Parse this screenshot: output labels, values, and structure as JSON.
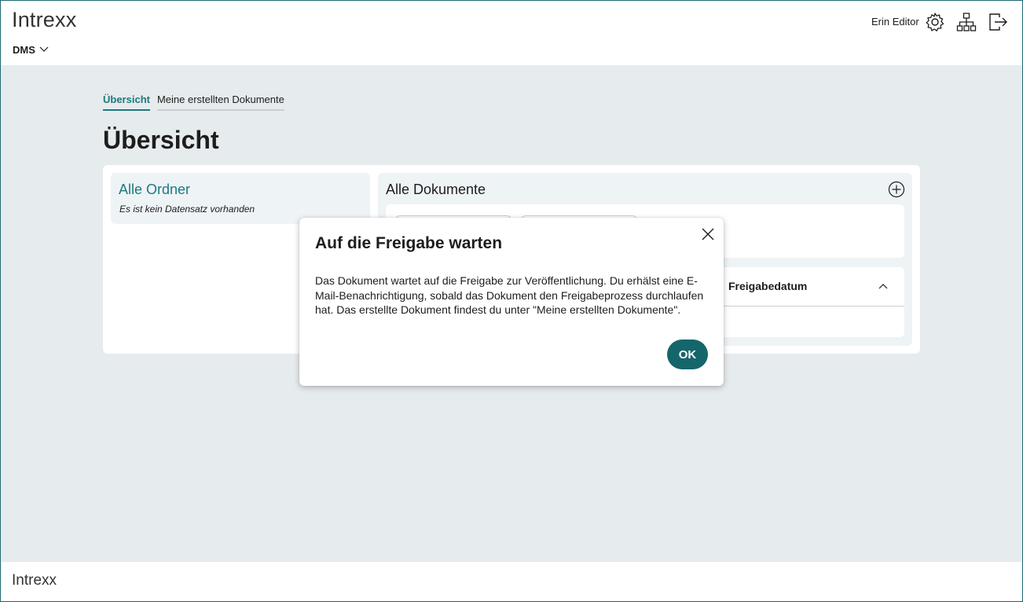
{
  "header": {
    "logo": "Intrexx",
    "app_menu_label": "DMS",
    "user_name": "Erin Editor",
    "icons": [
      "gear-icon",
      "sitemap-icon",
      "logout-icon"
    ]
  },
  "tabs": [
    {
      "label": "Übersicht",
      "active": true
    },
    {
      "label": "Meine erstellten Dokumente",
      "active": false
    }
  ],
  "page_title": "Übersicht",
  "folders": {
    "title": "Alle Ordner",
    "empty_text": "Es ist kein Datensatz vorhanden"
  },
  "documents": {
    "title": "Alle Dokumente",
    "column_header": "Freigabedatum"
  },
  "dialog": {
    "title": "Auf die Freigabe warten",
    "message": "Das Dokument wartet auf die Freigabe zur Veröffentlichung. Du erhälst eine E-Mail-Benachrichtigung, sobald das Dokument den Freigabeprozess durchlaufen hat. Das erstellte Dokument findest du unter \"Meine erstellten Dokumente\".",
    "ok_label": "OK"
  },
  "footer": {
    "logo": "Intrexx"
  },
  "colors": {
    "accent": "#1b7a80",
    "button": "#14666b",
    "background": "#e6ebed"
  }
}
